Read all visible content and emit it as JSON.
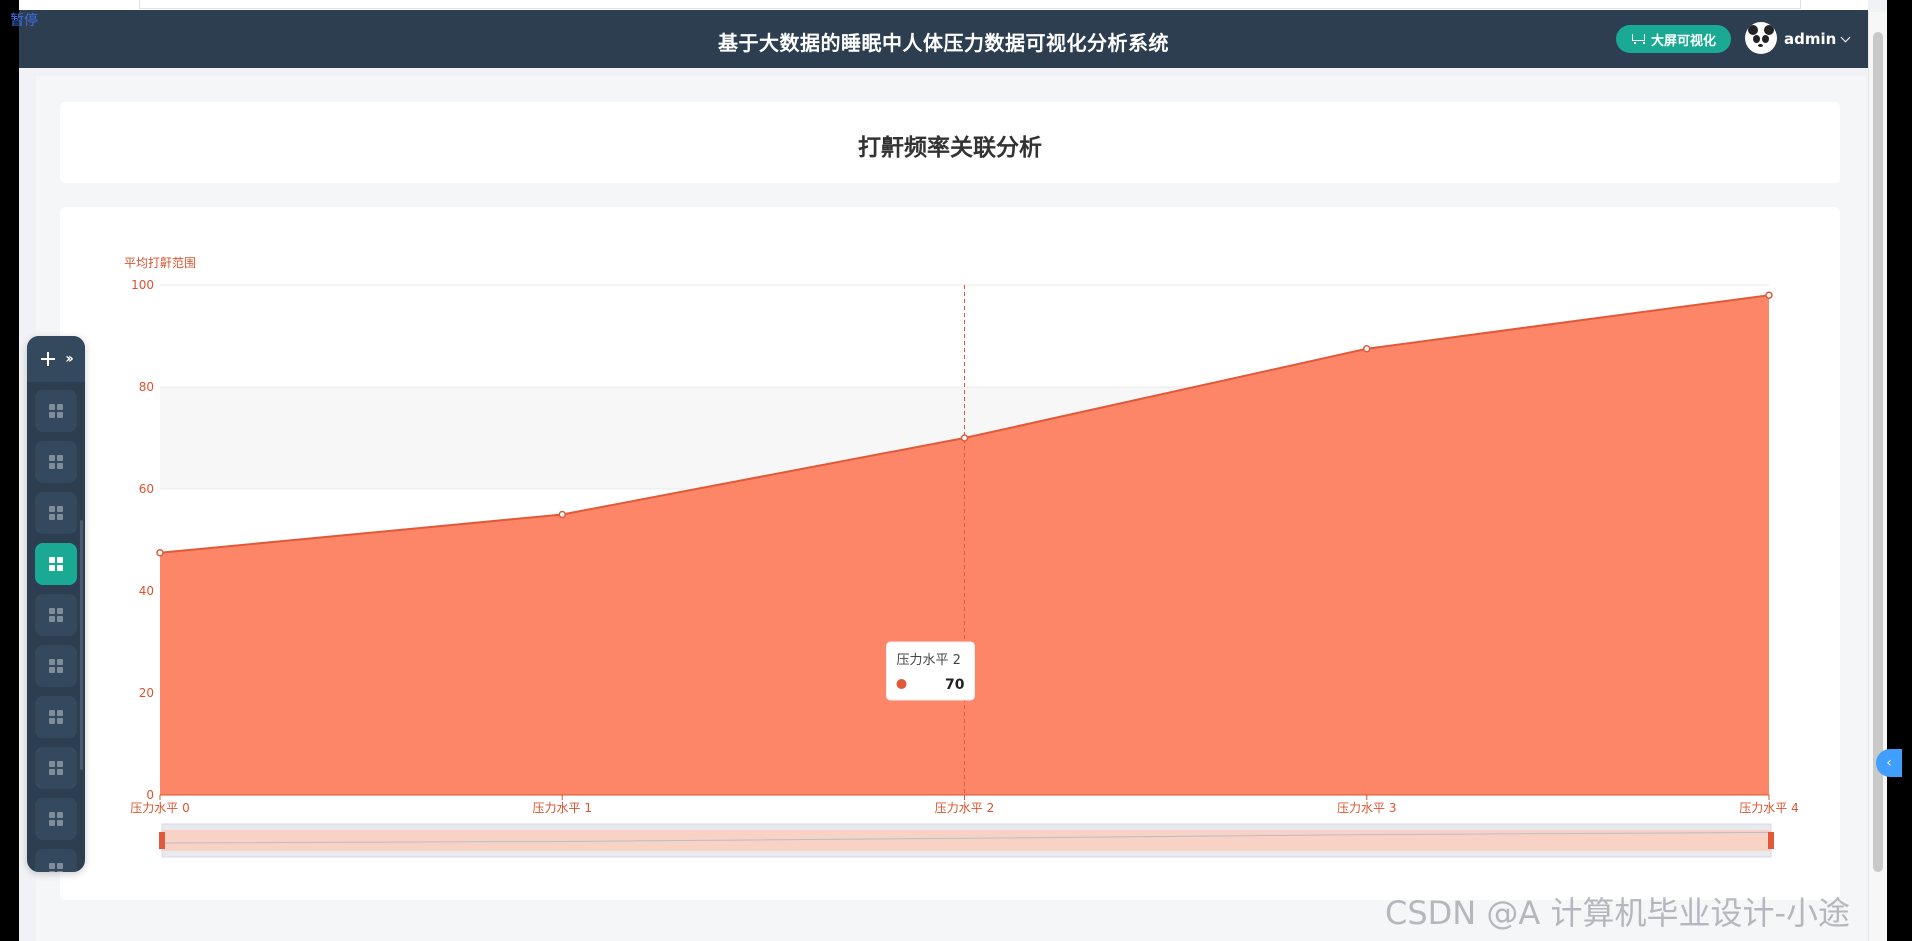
{
  "overlay": {
    "pause_label": "暂停"
  },
  "header": {
    "title": "基于大数据的睡眠中人体压力数据可视化分析系统",
    "screen_button": "大屏可视化",
    "username": "admin"
  },
  "page": {
    "title": "打鼾频率关联分析"
  },
  "sidebar": {
    "items": [
      {
        "active": false
      },
      {
        "active": false
      },
      {
        "active": false
      },
      {
        "active": true
      },
      {
        "active": false
      },
      {
        "active": false
      },
      {
        "active": false
      },
      {
        "active": false
      },
      {
        "active": false
      },
      {
        "active": false
      }
    ]
  },
  "colors": {
    "header_bg": "#2c3e50",
    "accent": "#1aaa94",
    "area_fill": "#fc7f5f",
    "line": "#e05a3a",
    "axis_text": "#d9542f"
  },
  "chart_data": {
    "type": "area",
    "ylabel": "平均打鼾范围",
    "categories": [
      "压力水平 0",
      "压力水平 1",
      "压力水平 2",
      "压力水平 3",
      "压力水平 4"
    ],
    "values": [
      47.5,
      55,
      70,
      87.5,
      98
    ],
    "ylim": [
      0,
      100
    ],
    "yticks": [
      0,
      20,
      40,
      60,
      80,
      100
    ],
    "grid": true,
    "tooltip": {
      "category": "压力水平 2",
      "value": "70"
    },
    "datazoom": true
  },
  "watermark": "CSDN @A 计算机毕业设计-小途"
}
